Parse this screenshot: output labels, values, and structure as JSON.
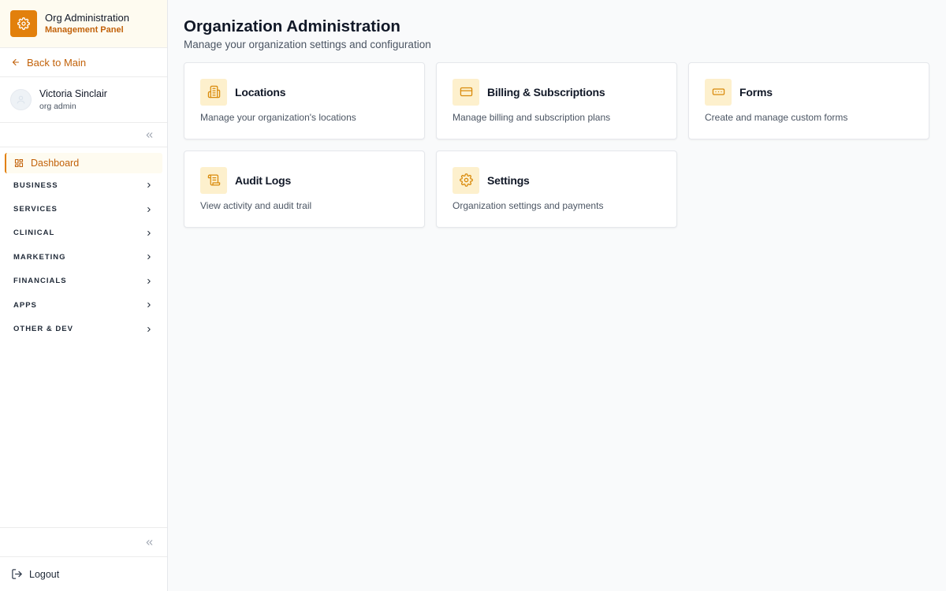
{
  "brand": {
    "title": "Org Administration",
    "subtitle": "Management Panel",
    "icon": "gear-icon",
    "accent": "#e2800c"
  },
  "back_link": {
    "label": "Back to Main",
    "icon": "arrow-left-icon"
  },
  "user": {
    "name": "Victoria Sinclair",
    "role": "org admin"
  },
  "nav": {
    "active": {
      "label": "Dashboard",
      "icon": "dashboard-grid-icon"
    },
    "sections": [
      {
        "label": "BUSINESS"
      },
      {
        "label": "SERVICES"
      },
      {
        "label": "CLINICAL"
      },
      {
        "label": "MARKETING"
      },
      {
        "label": "FINANCIALS"
      },
      {
        "label": "APPS"
      },
      {
        "label": "OTHER & DEV"
      }
    ]
  },
  "logout": {
    "label": "Logout",
    "icon": "logout-icon"
  },
  "main": {
    "title": "Organization Administration",
    "subtitle": "Manage your organization settings and configuration",
    "cards": [
      {
        "title": "Locations",
        "description": "Manage your organization's locations",
        "icon": "building-icon"
      },
      {
        "title": "Billing & Subscriptions",
        "description": "Manage billing and subscription plans",
        "icon": "credit-card-icon"
      },
      {
        "title": "Forms",
        "description": "Create and manage custom forms",
        "icon": "form-icon"
      },
      {
        "title": "Audit Logs",
        "description": "View activity and audit trail",
        "icon": "scroll-icon"
      },
      {
        "title": "Settings",
        "description": "Organization settings and payments",
        "icon": "gear-icon"
      }
    ]
  },
  "colors": {
    "accent": "#e2800c",
    "accent_text": "#c2620a",
    "icon_bg": "#fdf0cd",
    "brand_bg": "#fefbf0"
  }
}
